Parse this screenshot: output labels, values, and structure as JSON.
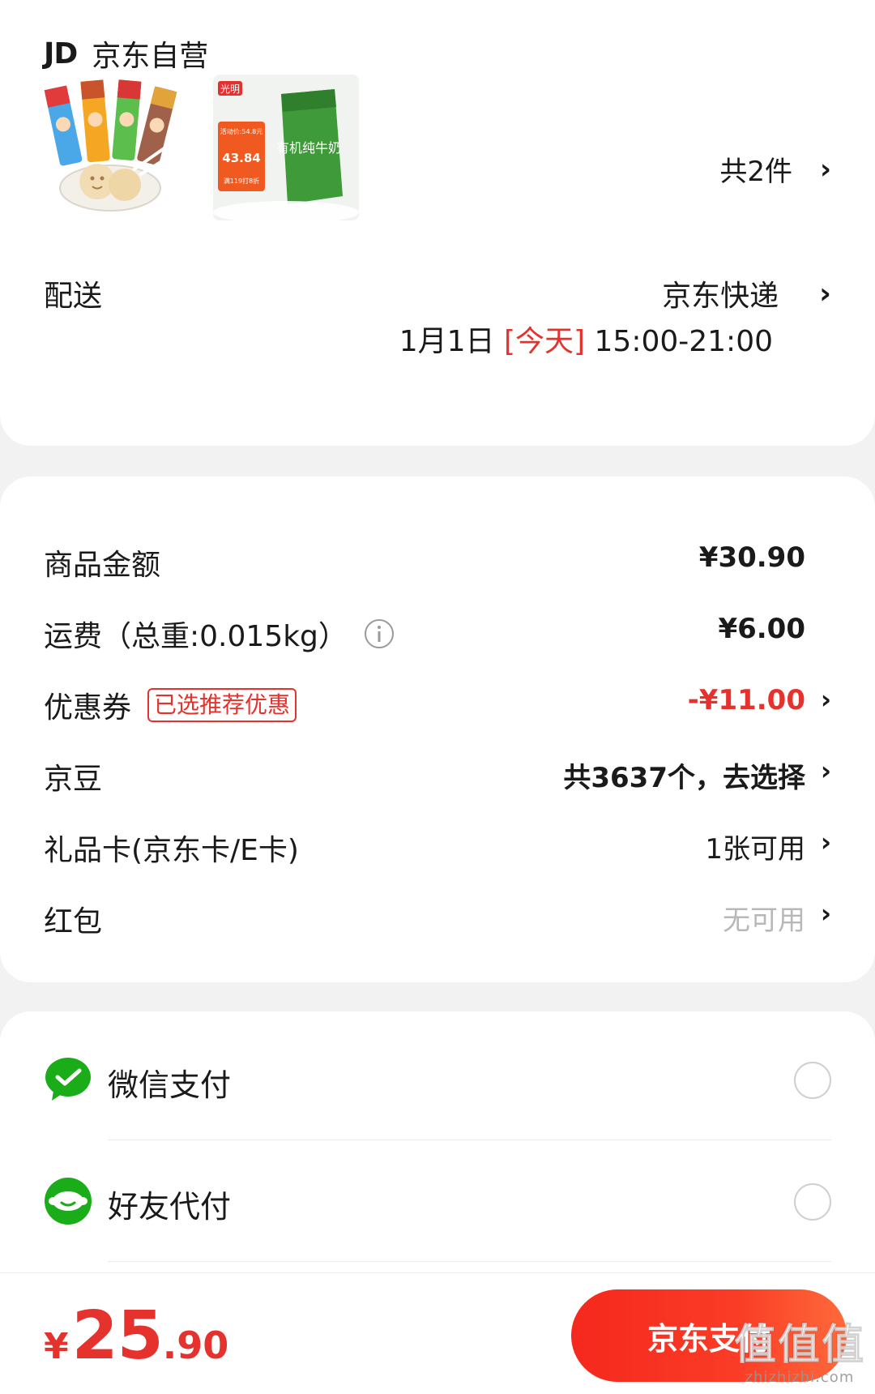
{
  "store": {
    "logo": "JD",
    "name": "京东自营"
  },
  "products": {
    "thumb2_texts": [
      "光明",
      "活动价:54.8元",
      "43.84",
      "满119打8折",
      "有机纯牛奶"
    ],
    "count_label": "共2件"
  },
  "delivery": {
    "label": "配送",
    "method": "京东快递",
    "date": "1月1日",
    "today": "[今天]",
    "time": "15:00-21:00"
  },
  "fees": {
    "goods_label": "商品金额",
    "goods_value": "¥30.90",
    "shipping_label": "运费（总重:0.015kg）",
    "shipping_value": "¥6.00",
    "coupon_label": "优惠券",
    "coupon_badge": "已选推荐优惠",
    "coupon_value": "-¥11.00",
    "beans_label": "京豆",
    "beans_value": "共3637个，去选择",
    "giftcard_label": "礼品卡(京东卡/E卡)",
    "giftcard_value": "1张可用",
    "redpacket_label": "红包",
    "redpacket_value": "无可用"
  },
  "payment": {
    "wechat_label": "微信支付",
    "friend_label": "好友代付"
  },
  "bottom": {
    "currency": "¥",
    "total_int": "25",
    "total_dec": ".90",
    "pay_button": "京东支付"
  },
  "watermark": {
    "main": "值值值",
    "sub": "zhizhizhi.com"
  },
  "colors": {
    "accent_red": "#e5322d",
    "wechat_green": "#1aad19",
    "muted": "#b8b8b8"
  }
}
